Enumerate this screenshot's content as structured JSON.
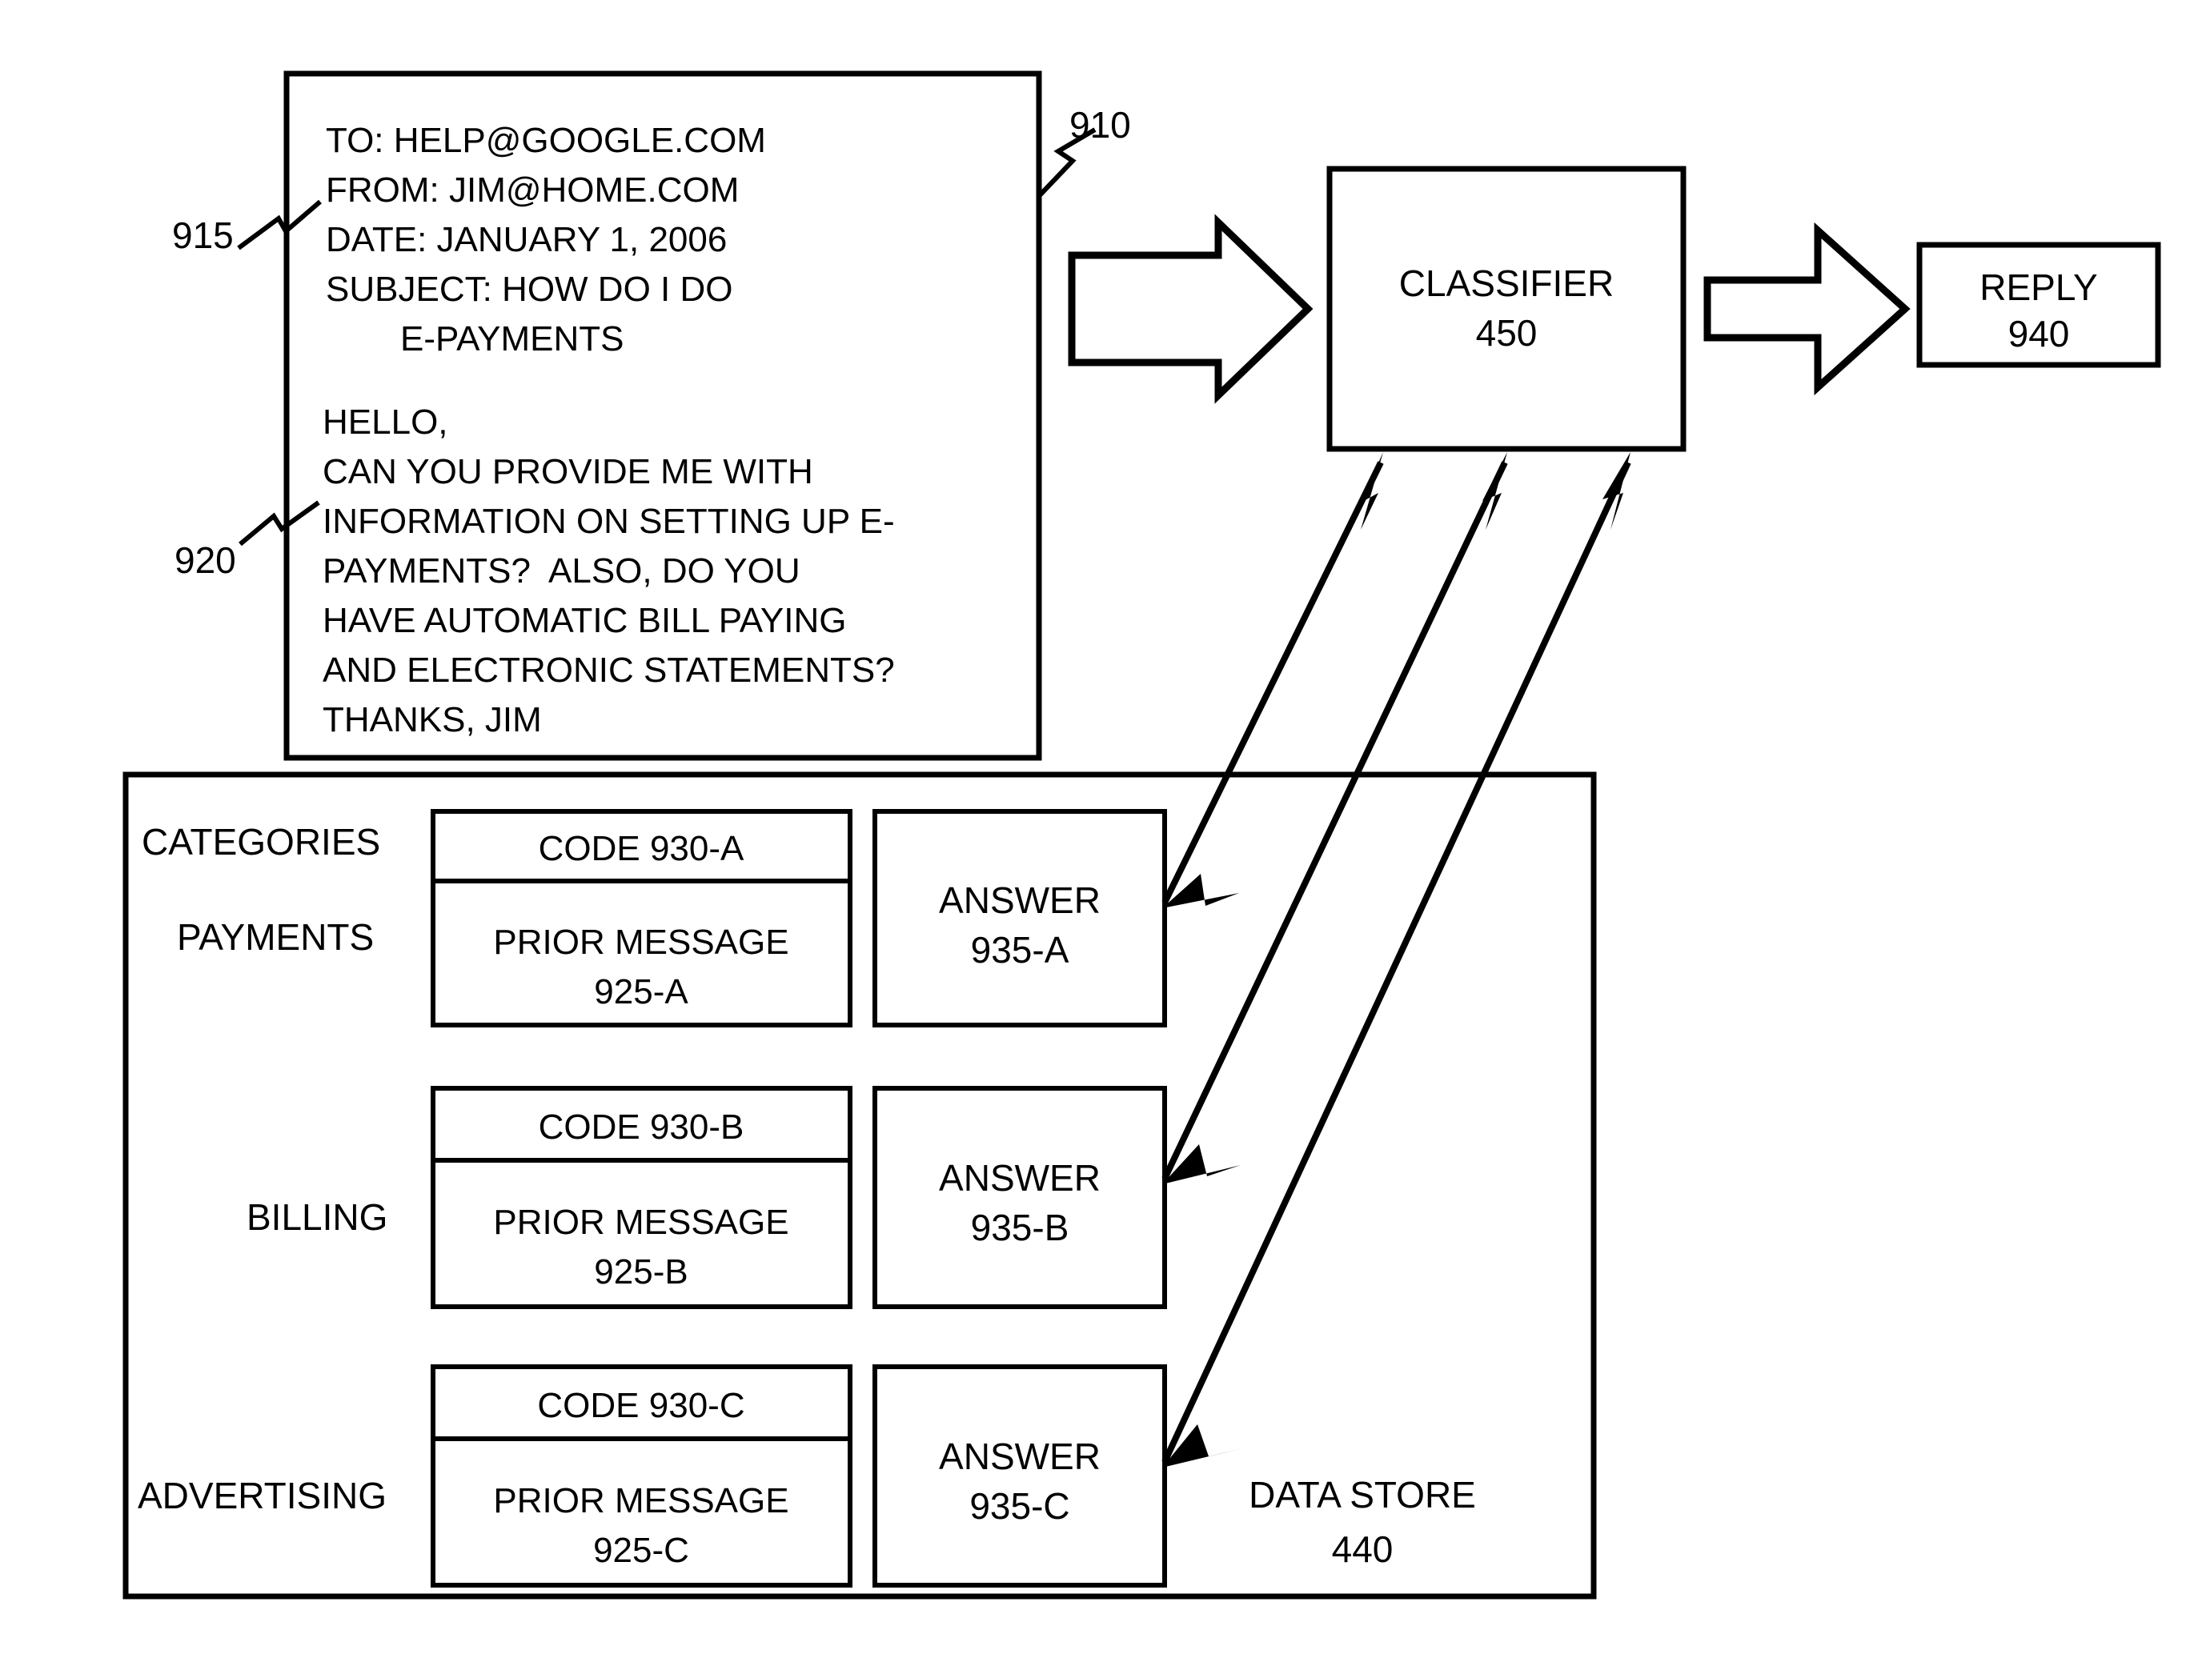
{
  "figure": {
    "email_box": {
      "ref_top": "910",
      "ref_header": "915",
      "ref_body": "920",
      "header_lines": [
        "TO: HELP@GOOGLE.COM",
        "FROM: JIM@HOME.COM",
        "DATE: JANUARY 1, 2006",
        "SUBJECT: HOW DO I DO",
        "E-PAYMENTS"
      ],
      "body_lines": [
        "HELLO,",
        "CAN YOU PROVIDE ME WITH",
        "INFORMATION ON SETTING UP E-",
        "PAYMENTS?  ALSO, DO YOU",
        "HAVE AUTOMATIC BILL PAYING",
        "AND ELECTRONIC STATEMENTS?",
        "THANKS, JIM"
      ]
    },
    "classifier": {
      "label": "CLASSIFIER",
      "ref": "450"
    },
    "reply": {
      "label": "REPLY",
      "ref": "940"
    },
    "data_store": {
      "label": "DATA STORE",
      "ref": "440",
      "categories_label": "CATEGORIES",
      "rows": [
        {
          "category": "PAYMENTS",
          "code_label": "CODE 930-A",
          "prior_message_line1": "PRIOR MESSAGE",
          "prior_message_line2": "925-A",
          "answer_line1": "ANSWER",
          "answer_line2": "935-A"
        },
        {
          "category": "BILLING",
          "code_label": "CODE 930-B",
          "prior_message_line1": "PRIOR MESSAGE",
          "prior_message_line2": "925-B",
          "answer_line1": "ANSWER",
          "answer_line2": "935-B"
        },
        {
          "category": "ADVERTISING",
          "code_label": "CODE 930-C",
          "prior_message_line1": "PRIOR MESSAGE",
          "prior_message_line2": "925-C",
          "answer_line1": "ANSWER",
          "answer_line2": "935-C"
        }
      ]
    },
    "colors": {
      "ink": "#000000",
      "paper": "#ffffff"
    }
  }
}
